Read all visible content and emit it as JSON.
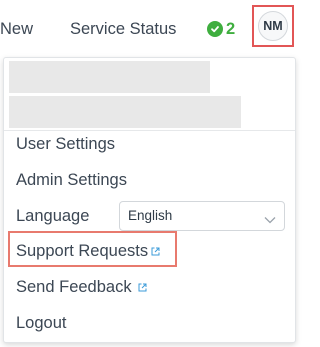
{
  "topbar": {
    "nav_new": "New",
    "nav_service_status": "Service Status",
    "status_count": "2",
    "avatar_initials": "NM"
  },
  "menu": {
    "user_settings": "User Settings",
    "admin_settings": "Admin Settings",
    "language_label": "Language",
    "language_value": "English",
    "support_requests": "Support Requests",
    "send_feedback": "Send Feedback",
    "logout": "Logout"
  },
  "colors": {
    "status_green": "#3fae3f",
    "highlight_red": "#e25656",
    "external_link_blue": "#3b9bd9"
  }
}
